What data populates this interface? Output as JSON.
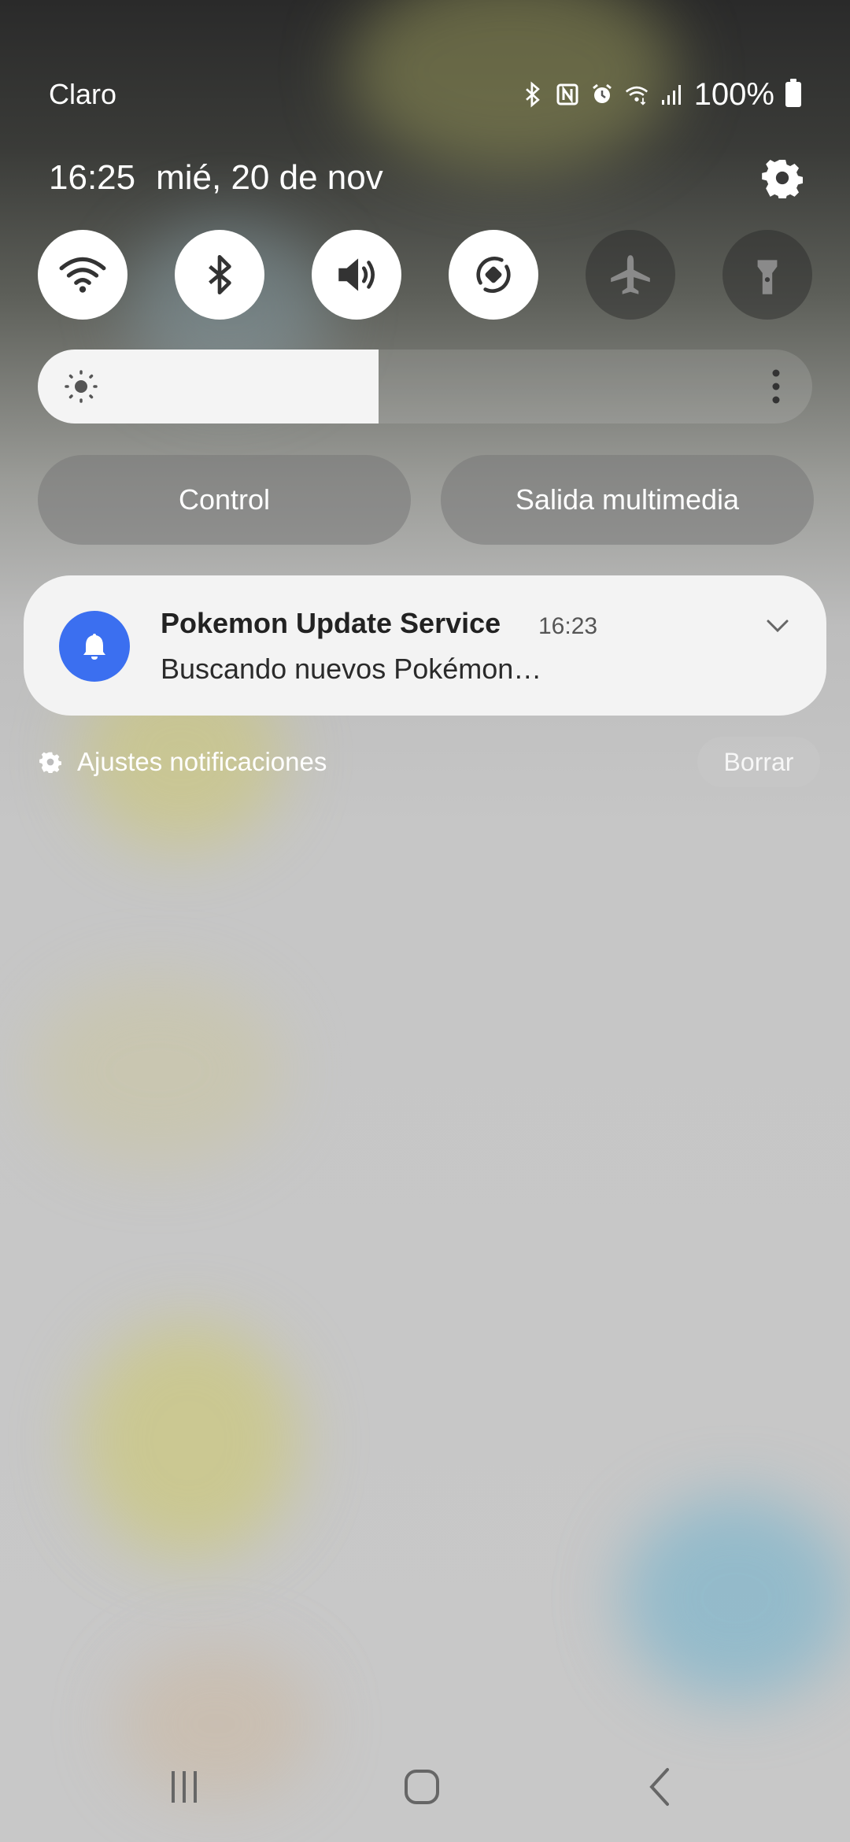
{
  "status_bar": {
    "carrier": "Claro",
    "battery_percent": "100%",
    "icons": [
      "bluetooth-icon",
      "nfc-icon",
      "alarm-icon",
      "wifi-data-icon",
      "signal-icon",
      "battery-icon"
    ]
  },
  "header": {
    "time": "16:25",
    "date": "mié, 20 de nov"
  },
  "quick_toggles": [
    {
      "name": "wifi",
      "icon": "wifi-icon",
      "state": "on"
    },
    {
      "name": "bluetooth",
      "icon": "bluetooth-icon",
      "state": "on"
    },
    {
      "name": "sound",
      "icon": "volume-icon",
      "state": "on"
    },
    {
      "name": "auto-rotate",
      "icon": "rotate-icon",
      "state": "on"
    },
    {
      "name": "airplane",
      "icon": "airplane-icon",
      "state": "off"
    },
    {
      "name": "flashlight",
      "icon": "flashlight-icon",
      "state": "off"
    }
  ],
  "brightness": {
    "level": 0.44
  },
  "buttons": {
    "control": "Control",
    "media_output": "Salida multimedia"
  },
  "notification": {
    "app": "Pokemon Update Service",
    "time": "16:23",
    "text": "Buscando nuevos Pokémon…",
    "accent": "#3b6ff0"
  },
  "footer": {
    "settings_label": "Ajustes notificaciones",
    "clear_label": "Borrar"
  }
}
